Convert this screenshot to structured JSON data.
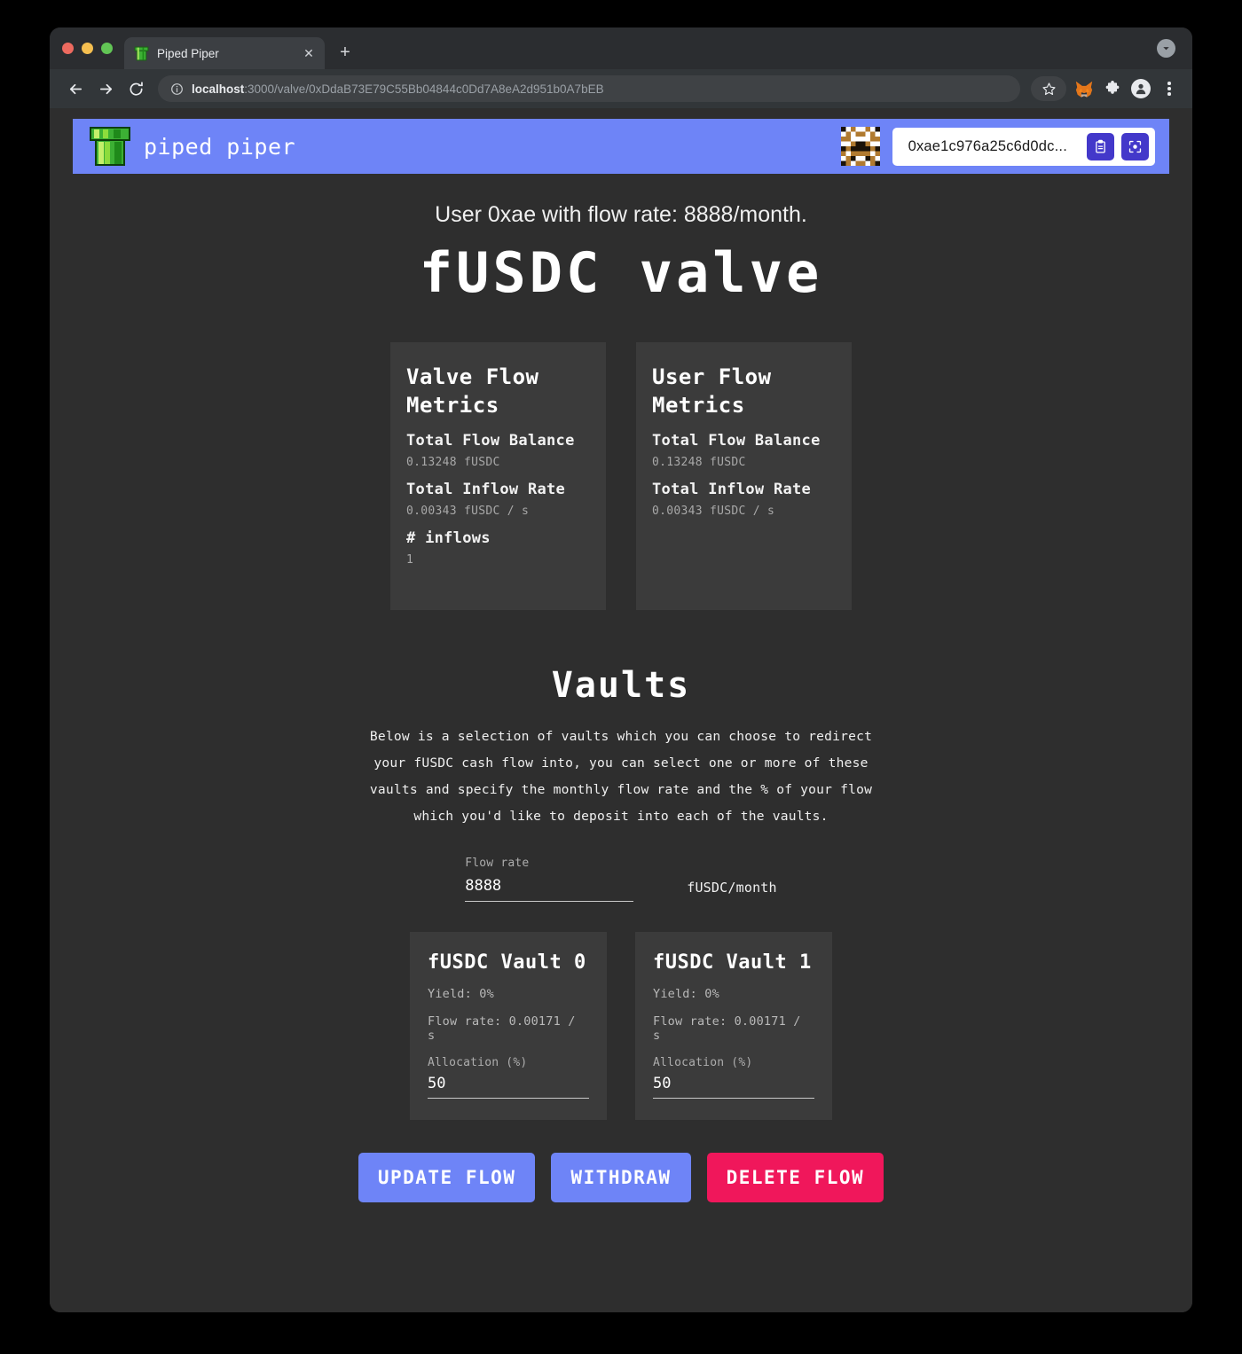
{
  "browser": {
    "tab": {
      "title": "Piped Piper",
      "favicon_icon": "pipe-icon",
      "close_icon": "close-icon"
    },
    "new_tab_label": "+",
    "tab_search_icon": "chevron-down-icon",
    "nav": {
      "back_icon": "back-arrow-icon",
      "forward_icon": "forward-arrow-icon",
      "reload_icon": "reload-icon"
    },
    "omnibox": {
      "info_icon": "info-circle-icon",
      "host": "localhost",
      "path": ":3000/valve/0xDdaB73E79C55Bb04844c0Dd7A8eA2d951b0A7bEB"
    },
    "toolbar_icons": {
      "bookmark": "star-icon",
      "metamask": "metamask-fox-icon",
      "extensions": "puzzle-piece-icon",
      "profile": "user-avatar-icon",
      "menu": "kebab-menu-icon"
    }
  },
  "app": {
    "header": {
      "logo_icon": "green-pipe-logo-icon",
      "brand": "piped piper",
      "avatar_icon": "blockie-identicon",
      "wallet_address": "0xae1c976a25c6d0dc...",
      "copy_icon": "clipboard-icon",
      "scan_icon": "qr-scan-icon"
    },
    "hero": {
      "subtitle": "User 0xae with flow rate: 8888/month.",
      "title": "fUSDC valve"
    },
    "metric_cards": [
      {
        "title": "Valve Flow Metrics",
        "rows": [
          {
            "label": "Total Flow Balance",
            "value": "0.13248 fUSDC"
          },
          {
            "label": "Total Inflow Rate",
            "value": "0.00343 fUSDC / s"
          },
          {
            "label": "# inflows",
            "value": "1"
          }
        ]
      },
      {
        "title": "User Flow Metrics",
        "rows": [
          {
            "label": "Total Flow Balance",
            "value": "0.13248 fUSDC"
          },
          {
            "label": "Total Inflow Rate",
            "value": "0.00343 fUSDC / s"
          }
        ]
      }
    ],
    "vaults": {
      "heading": "Vaults",
      "description": "Below is a selection of vaults which you can choose to redirect your fUSDC cash flow into, you can select one or more of these vaults and specify the monthly flow rate and the % of your flow which you'd like to deposit into each of the vaults.",
      "flow_rate": {
        "label": "Flow rate",
        "value": "8888",
        "placeholder": "0",
        "unit": "fUSDC/month"
      },
      "cards": [
        {
          "title": "fUSDC Vault 0",
          "yield": "Yield: 0%",
          "flow_rate": "Flow rate: 0.00171 / s",
          "allocation_label": "Allocation (%)",
          "allocation_value": "50",
          "allocation_placeholder": "0"
        },
        {
          "title": "fUSDC Vault 1",
          "yield": "Yield: 0%",
          "flow_rate": "Flow rate: 0.00171 / s",
          "allocation_label": "Allocation (%)",
          "allocation_value": "50",
          "allocation_placeholder": "0"
        }
      ]
    },
    "actions": {
      "update_flow": "UPDATE FLOW",
      "withdraw": "WITHDRAW",
      "delete_flow": "DELETE FLOW"
    },
    "colors": {
      "brand_blue": "#6e84f7",
      "danger_pink": "#f0175b",
      "chip_indigo": "#4338ca",
      "page_bg": "#2e2e2e",
      "card_bg": "#3b3b3b"
    }
  }
}
